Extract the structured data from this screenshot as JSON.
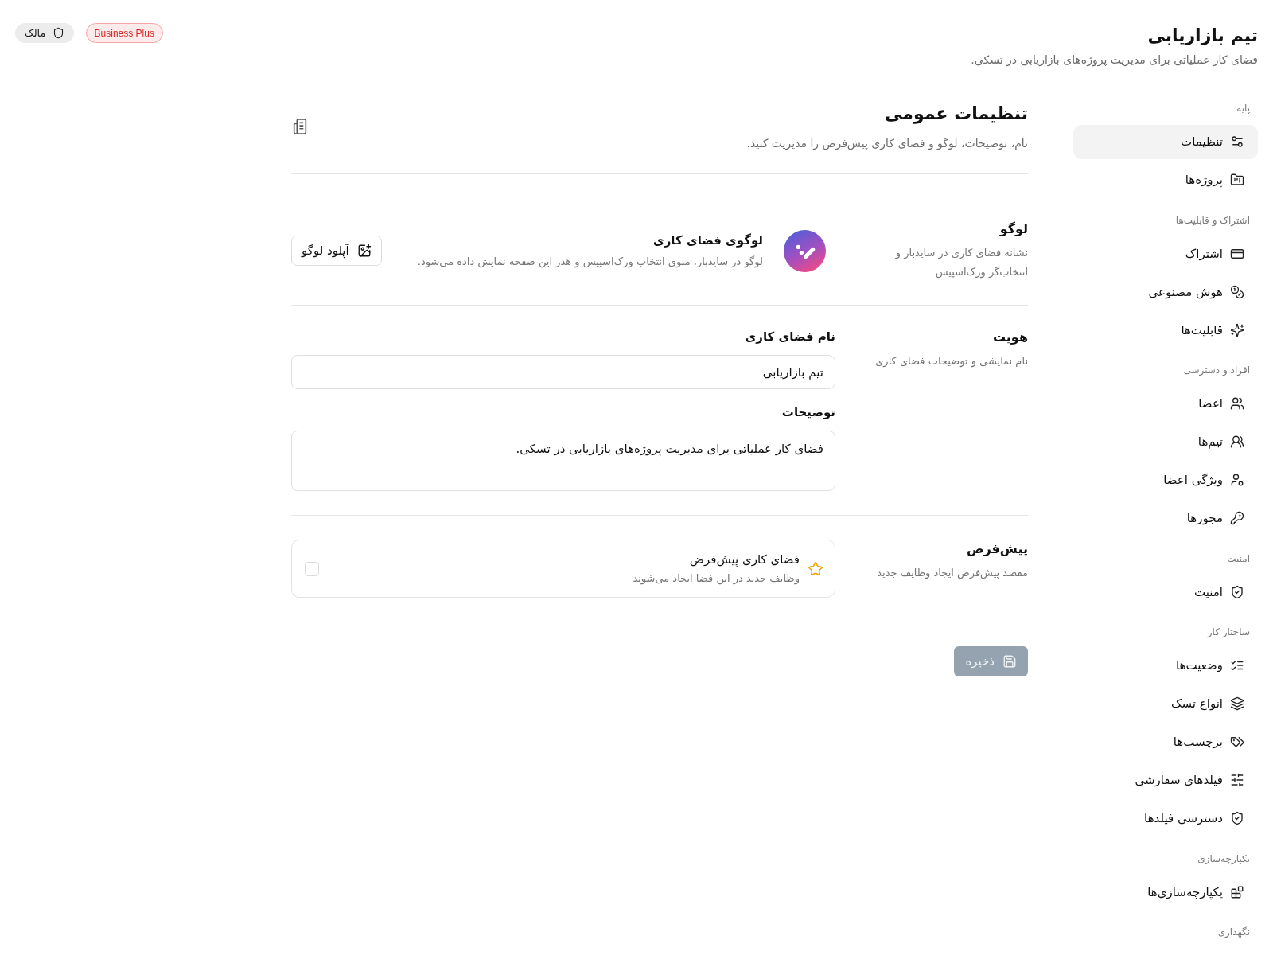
{
  "header": {
    "title": "تیم بازاریابی",
    "subtitle": "فضای کار عملیاتی برای مدیریت پروژه‌های بازاریابی در تسکی.",
    "badges": [
      {
        "kind": "plan",
        "label": "Business Plus"
      },
      {
        "kind": "role",
        "label": "مالک"
      }
    ]
  },
  "sidebar": {
    "sections": [
      {
        "label": "پایه",
        "items": [
          {
            "label": "تنظیمات",
            "selected": true
          },
          {
            "label": "پروژه‌ها",
            "selected": false
          }
        ]
      },
      {
        "label": "اشتراک و قابلیت‌ها",
        "items": [
          {
            "label": "اشتراک",
            "selected": false
          },
          {
            "label": "هوش مصنوعی",
            "selected": false
          },
          {
            "label": "قابلیت‌ها",
            "selected": false
          }
        ]
      },
      {
        "label": "افراد و دسترسی",
        "items": [
          {
            "label": "اعضا",
            "selected": false
          },
          {
            "label": "تیم‌ها",
            "selected": false
          },
          {
            "label": "ویژگی اعضا",
            "selected": false
          },
          {
            "label": "مجوزها",
            "selected": false
          }
        ]
      },
      {
        "label": "امنیت",
        "items": [
          {
            "label": "امنیت",
            "selected": false
          }
        ]
      },
      {
        "label": "ساختار کار",
        "items": [
          {
            "label": "وضعیت‌ها",
            "selected": false
          },
          {
            "label": "انواع تسک",
            "selected": false
          },
          {
            "label": "برچسب‌ها",
            "selected": false
          },
          {
            "label": "فیلدهای سفارشی",
            "selected": false
          },
          {
            "label": "دسترسی فیلدها",
            "selected": false
          }
        ]
      },
      {
        "label": "یکپارچه‌سازی",
        "items": [
          {
            "label": "یکپارچه‌سازی‌ها",
            "selected": false
          }
        ]
      },
      {
        "label": "نگهداری"
      }
    ]
  },
  "page": {
    "title": "تنظیمات عمومی",
    "subtitle": "نام، توضیحات، لوگو و فضای کاری پیش‌فرض را مدیریت کنید."
  },
  "sections": [
    {
      "kind": "logo",
      "title": "لوگو",
      "description": "نشانه فضای کاری در سایدبار و انتخاب‌گر ورک‌اسپیس",
      "logo": {
        "title": "لوگوی فضای کاری",
        "description": "لوگو در سایدبار، منوی انتخاب ورک‌اسپیس و هدر این صفحه نمایش داده می‌شود."
      },
      "button": "آپلود لوگو"
    },
    {
      "kind": "identity",
      "title": "هویت",
      "description": "نام نمایشی و توضیحات فضای کاری",
      "fields": [
        {
          "kind": "input",
          "label": "نام فضای کاری",
          "value": "تیم بازاریابی"
        },
        {
          "kind": "textarea",
          "label": "توضیحات",
          "value": "فضای کار عملیاتی برای مدیریت پروژه‌های بازاریابی در تسکی."
        }
      ]
    },
    {
      "kind": "default",
      "title": "پیش‌فرض",
      "description": "مقصد پیش‌فرض ایجاد وظایف جدید",
      "option": {
        "title": "فضای کاری پیش‌فرض",
        "description": "وظایف جدید در این فضا ایجاد می‌شوند",
        "checked": false
      }
    }
  ],
  "save_button": {
    "label": "ذخیره",
    "disabled": true
  }
}
